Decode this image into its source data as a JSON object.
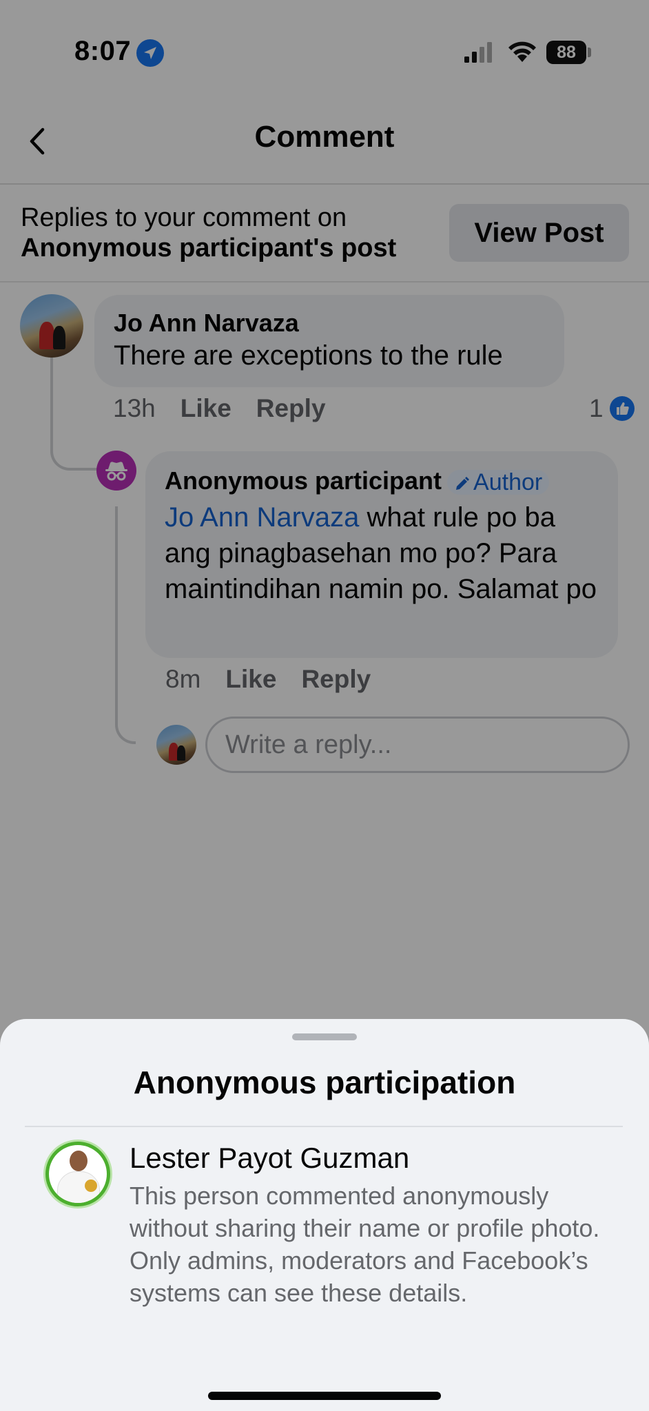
{
  "status_bar": {
    "time": "8:07",
    "battery": "88"
  },
  "nav": {
    "title": "Comment"
  },
  "banner": {
    "line1": "Replies to your comment on",
    "line2": "Anonymous participant's post",
    "view_post_label": "View Post"
  },
  "comment": {
    "author": "Jo Ann Narvaza",
    "text": "There are exceptions to the rule",
    "time": "13h",
    "like_label": "Like",
    "reply_label": "Reply",
    "like_count": "1"
  },
  "reply": {
    "author": "Anonymous participant",
    "badge": "Author",
    "mention": "Jo Ann Narvaza",
    "text": "what rule po ba ang pinagbasehan mo po? Para maintindihan namin po. Salamat po",
    "time": "8m",
    "like_label": "Like",
    "reply_label": "Reply"
  },
  "reply_input": {
    "placeholder": "Write a reply..."
  },
  "sheet": {
    "title": "Anonymous participation",
    "person_name": "Lester Payot Guzman",
    "description": "This person commented anonymously without sharing their name or profile photo. Only admins, moderators and Facebook’s systems can see these details."
  },
  "colors": {
    "brand": "#1877f2",
    "mention": "#1763cf",
    "anon_avatar": "#b830b8",
    "sheet_bg": "#f0f2f5"
  }
}
